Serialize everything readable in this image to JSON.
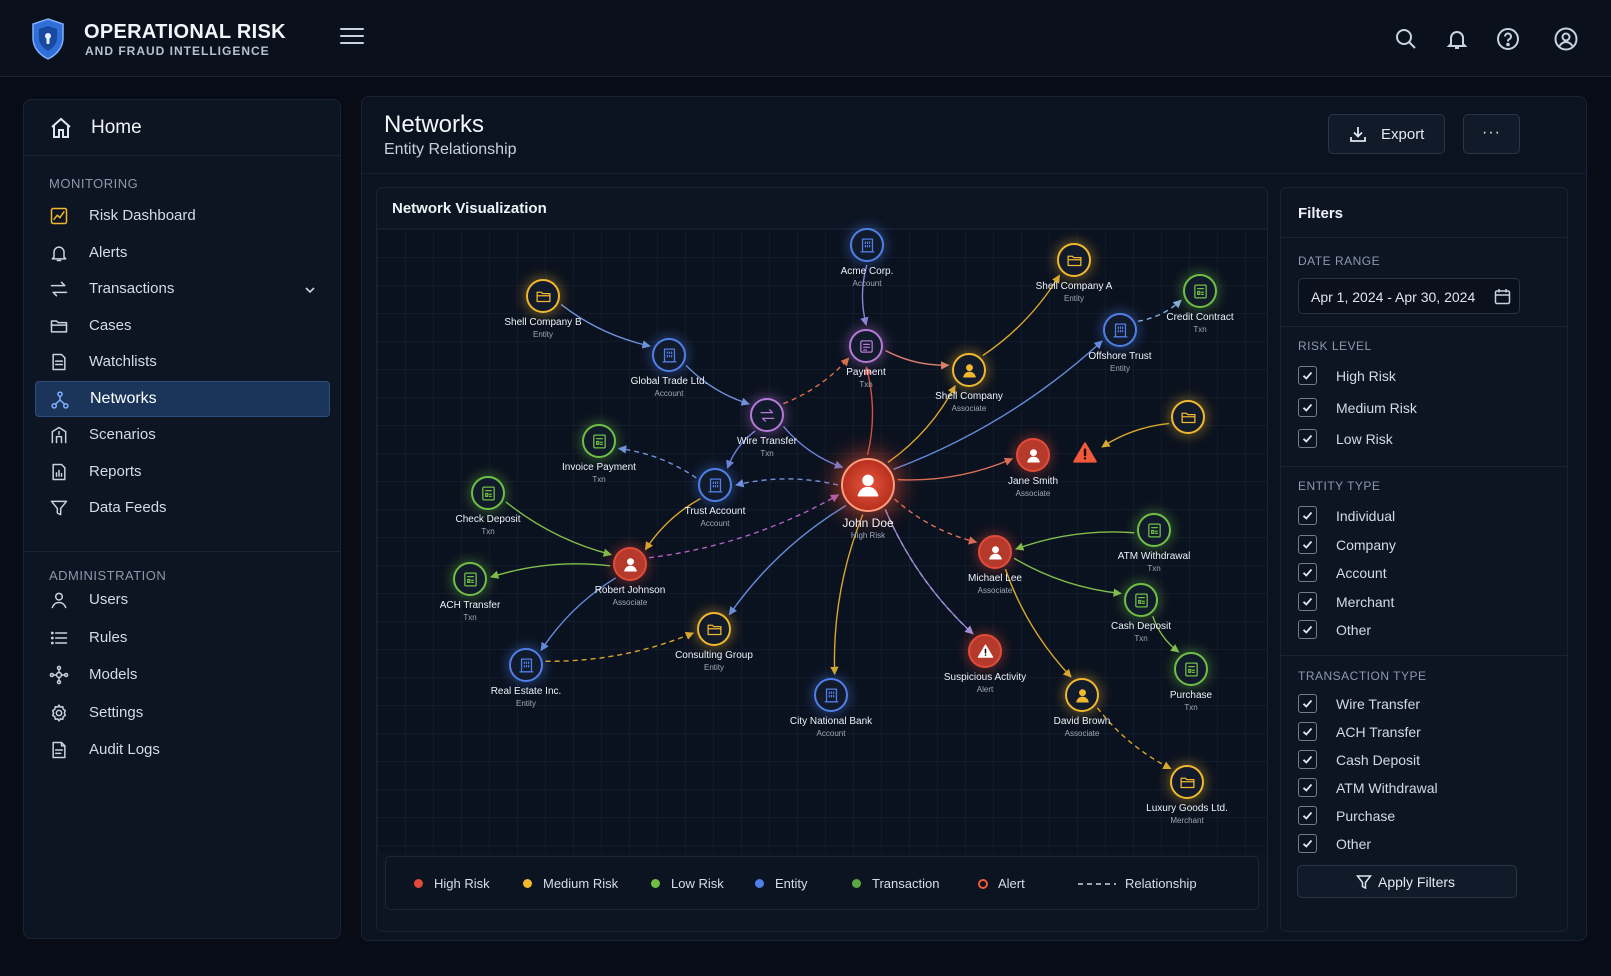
{
  "app": {
    "title_line1": "OPERATIONAL RISK",
    "title_line2": "AND FRAUD INTELLIGENCE"
  },
  "topbar_icons": [
    "search-icon",
    "bell-icon",
    "help-icon",
    "user-icon"
  ],
  "sidebar": {
    "home_label": "Home",
    "monitoring_title": "MONITORING",
    "monitoring_items": [
      {
        "label": "Risk Dashboard",
        "icon": "dashboard-icon",
        "active": false
      },
      {
        "label": "Alerts",
        "icon": "bell-icon",
        "active": false
      },
      {
        "label": "Transactions",
        "icon": "transfer-icon",
        "active": false,
        "expandable": true
      },
      {
        "label": "Cases",
        "icon": "folder-icon",
        "active": false
      },
      {
        "label": "Watchlists",
        "icon": "list-doc-icon",
        "active": false
      },
      {
        "label": "Networks",
        "icon": "network-icon",
        "active": true
      },
      {
        "label": "Scenarios",
        "icon": "scenario-icon",
        "active": false
      },
      {
        "label": "Reports",
        "icon": "report-icon",
        "active": false
      },
      {
        "label": "Data Feeds",
        "icon": "funnel-icon",
        "active": false
      }
    ],
    "admin_title": "ADMINISTRATION",
    "admin_items": [
      {
        "label": "Users",
        "icon": "user-icon"
      },
      {
        "label": "Rules",
        "icon": "list-icon"
      },
      {
        "label": "Models",
        "icon": "model-icon"
      },
      {
        "label": "Settings",
        "icon": "gear-icon"
      },
      {
        "label": "Audit Logs",
        "icon": "doc-icon"
      }
    ]
  },
  "main": {
    "title": "Networks",
    "subtitle": "Entity Relationship",
    "export_label": "Export",
    "more_label": "···",
    "viz_title": "Network Visualization"
  },
  "network": {
    "colors": {
      "high_risk": "#e24b3a",
      "medium_risk": "#f0b72f",
      "low_risk": "#6fbf45",
      "entity": "#4f7fe8",
      "transaction": "#5aa843",
      "alert": "#f05a3a",
      "payment": "#b57ad6"
    },
    "nodes": [
      {
        "id": "john",
        "name": "John Doe",
        "type": "High Risk",
        "kind": "high",
        "icon": "person-icon"
      },
      {
        "id": "acme",
        "name": "Acme Corp.",
        "type": "Account",
        "kind": "entity",
        "icon": "building-icon"
      },
      {
        "id": "payment",
        "name": "Payment",
        "type": "Txn",
        "kind": "payment",
        "icon": "payment-icon"
      },
      {
        "id": "shellA",
        "name": "Shell Company A",
        "type": "Entity",
        "kind": "medium",
        "icon": "folder-icon"
      },
      {
        "id": "shellB",
        "name": "Shell Company B",
        "type": "Entity",
        "kind": "medium",
        "icon": "folder-icon"
      },
      {
        "id": "global",
        "name": "Global Trade Ltd.",
        "type": "Account",
        "kind": "entity",
        "icon": "building-icon"
      },
      {
        "id": "wire",
        "name": "Wire Transfer",
        "type": "Txn",
        "kind": "payment",
        "icon": "transfer-icon"
      },
      {
        "id": "shellCo",
        "name": "Shell Company",
        "type": "Associate",
        "kind": "medium",
        "icon": "person-icon"
      },
      {
        "id": "offshore",
        "name": "Offshore Trust",
        "type": "Entity",
        "kind": "entity",
        "icon": "building-icon"
      },
      {
        "id": "credit",
        "name": "Credit Contract",
        "type": "Txn",
        "kind": "low",
        "icon": "receipt-icon"
      },
      {
        "id": "folderR",
        "name": "",
        "type": "",
        "kind": "medium",
        "icon": "folder-icon"
      },
      {
        "id": "alertA",
        "name": "",
        "type": "",
        "kind": "alert",
        "icon": "warning-icon"
      },
      {
        "id": "jane",
        "name": "Jane Smith",
        "type": "Associate",
        "kind": "high",
        "icon": "person-icon"
      },
      {
        "id": "invoice",
        "name": "Invoice Payment",
        "type": "Txn",
        "kind": "low",
        "icon": "receipt-icon"
      },
      {
        "id": "trust",
        "name": "Trust Account",
        "type": "Account",
        "kind": "entity",
        "icon": "building-icon"
      },
      {
        "id": "check",
        "name": "Check Deposit",
        "type": "Txn",
        "kind": "low",
        "icon": "receipt-icon"
      },
      {
        "id": "robert",
        "name": "Robert Johnson",
        "type": "Associate",
        "kind": "high",
        "icon": "person-icon"
      },
      {
        "id": "ach",
        "name": "ACH Transfer",
        "type": "Txn",
        "kind": "low",
        "icon": "receipt-icon"
      },
      {
        "id": "realestate",
        "name": "Real Estate Inc.",
        "type": "Entity",
        "kind": "entity",
        "icon": "building-icon"
      },
      {
        "id": "consulting",
        "name": "Consulting Group",
        "type": "Entity",
        "kind": "medium",
        "icon": "folder-icon"
      },
      {
        "id": "citybank",
        "name": "City National Bank",
        "type": "Account",
        "kind": "entity",
        "icon": "building-icon"
      },
      {
        "id": "suspicious",
        "name": "Suspicious Activity",
        "type": "Alert",
        "kind": "high",
        "icon": "warning-icon"
      },
      {
        "id": "michael",
        "name": "Michael Lee",
        "type": "Associate",
        "kind": "high",
        "icon": "person-icon"
      },
      {
        "id": "atm",
        "name": "ATM Withdrawal",
        "type": "Txn",
        "kind": "low",
        "icon": "receipt-icon"
      },
      {
        "id": "cash",
        "name": "Cash Deposit",
        "type": "Txn",
        "kind": "low",
        "icon": "receipt-icon"
      },
      {
        "id": "purchase",
        "name": "Purchase",
        "type": "Txn",
        "kind": "low",
        "icon": "receipt-icon"
      },
      {
        "id": "david",
        "name": "David Brown",
        "type": "Associate",
        "kind": "medium",
        "icon": "person-icon"
      },
      {
        "id": "luxury",
        "name": "Luxury Goods Ltd.",
        "type": "Merchant",
        "kind": "medium",
        "icon": "folder-icon"
      }
    ],
    "edges": [
      {
        "from": "john",
        "to": "payment",
        "color": "#e55a4a"
      },
      {
        "from": "acme",
        "to": "payment",
        "color": "#9a8fe8"
      },
      {
        "from": "payment",
        "to": "shellCo",
        "color": "#f08a7a"
      },
      {
        "from": "wire",
        "to": "payment",
        "color": "#f07a4a",
        "dashed": true
      },
      {
        "from": "john",
        "to": "shellCo",
        "color": "#f0b72f"
      },
      {
        "from": "shellCo",
        "to": "shellA",
        "color": "#f0b72f"
      },
      {
        "from": "shellB",
        "to": "global",
        "color": "#7aa0f0"
      },
      {
        "from": "global",
        "to": "wire",
        "color": "#7aa0f0"
      },
      {
        "from": "wire",
        "to": "john",
        "color": "#7a8ff0"
      },
      {
        "from": "wire",
        "to": "trust",
        "color": "#7a8ff0"
      },
      {
        "from": "john",
        "to": "trust",
        "color": "#7aa0f0",
        "dashed": true
      },
      {
        "from": "trust",
        "to": "invoice",
        "color": "#7aa0f0",
        "dashed": true
      },
      {
        "from": "john",
        "to": "offshore",
        "color": "#6f9af0"
      },
      {
        "from": "offshore",
        "to": "credit",
        "color": "#8fc0f0",
        "dashed": true
      },
      {
        "from": "john",
        "to": "jane",
        "color": "#f07a5a"
      },
      {
        "from": "folderR",
        "to": "alertA",
        "color": "#f0b72f"
      },
      {
        "from": "trust",
        "to": "robert",
        "color": "#f0b72f"
      },
      {
        "from": "check",
        "to": "robert",
        "color": "#8fd04f"
      },
      {
        "from": "robert",
        "to": "ach",
        "color": "#8fd04f"
      },
      {
        "from": "robert",
        "to": "realestate",
        "color": "#6f9af0"
      },
      {
        "from": "robert",
        "to": "john",
        "color": "#c06ad0",
        "dashed": true
      },
      {
        "from": "john",
        "to": "consulting",
        "color": "#6f9af0"
      },
      {
        "from": "john",
        "to": "citybank",
        "color": "#f0b72f"
      },
      {
        "from": "john",
        "to": "suspicious",
        "color": "#f0b72f",
        "dashed": true
      },
      {
        "from": "john",
        "to": "suspicious",
        "color": "#9a8ff0"
      },
      {
        "from": "john",
        "to": "michael",
        "color": "#f07a5a",
        "dashed": true
      },
      {
        "from": "atm",
        "to": "michael",
        "color": "#8fd04f"
      },
      {
        "from": "michael",
        "to": "cash",
        "color": "#8fd04f"
      },
      {
        "from": "cash",
        "to": "purchase",
        "color": "#8fd04f"
      },
      {
        "from": "michael",
        "to": "david",
        "color": "#f0b72f"
      },
      {
        "from": "david",
        "to": "luxury",
        "color": "#f0b72f",
        "dashed": true
      },
      {
        "from": "realestate",
        "to": "consulting",
        "color": "#f0b72f",
        "dashed": true
      }
    ]
  },
  "legend": [
    {
      "label": "High Risk",
      "color": "#e24b3a",
      "style": "dot"
    },
    {
      "label": "Medium Risk",
      "color": "#f0b72f",
      "style": "dot"
    },
    {
      "label": "Low Risk",
      "color": "#6fbf45",
      "style": "dot"
    },
    {
      "label": "Entity",
      "color": "#4f7fe8",
      "style": "dot"
    },
    {
      "label": "Transaction",
      "color": "#5aa843",
      "style": "dot"
    },
    {
      "label": "Alert",
      "color": "#f05a3a",
      "style": "ring"
    },
    {
      "label": "Relationship",
      "color": "#d0d6e0",
      "style": "dashed-line"
    }
  ],
  "filters": {
    "title": "Filters",
    "date_range_title": "DATE RANGE",
    "date_range_value": "Apr 1, 2024 - Apr 30, 2024",
    "risk_level_title": "RISK LEVEL",
    "risk_levels": [
      {
        "label": "High Risk",
        "checked": true
      },
      {
        "label": "Medium Risk",
        "checked": true
      },
      {
        "label": "Low Risk",
        "checked": true
      }
    ],
    "entity_type_title": "ENTITY TYPE",
    "entity_types": [
      {
        "label": "Individual",
        "checked": true
      },
      {
        "label": "Company",
        "checked": true
      },
      {
        "label": "Account",
        "checked": true
      },
      {
        "label": "Merchant",
        "checked": true
      },
      {
        "label": "Other",
        "checked": true
      }
    ],
    "transaction_type_title": "TRANSACTION TYPE",
    "transaction_types": [
      {
        "label": "Wire Transfer",
        "checked": true
      },
      {
        "label": "ACH Transfer",
        "checked": true
      },
      {
        "label": "Cash Deposit",
        "checked": true
      },
      {
        "label": "ATM Withdrawal",
        "checked": true
      },
      {
        "label": "Purchase",
        "checked": true
      },
      {
        "label": "Other",
        "checked": true
      }
    ],
    "apply_label": "Apply Filters"
  }
}
